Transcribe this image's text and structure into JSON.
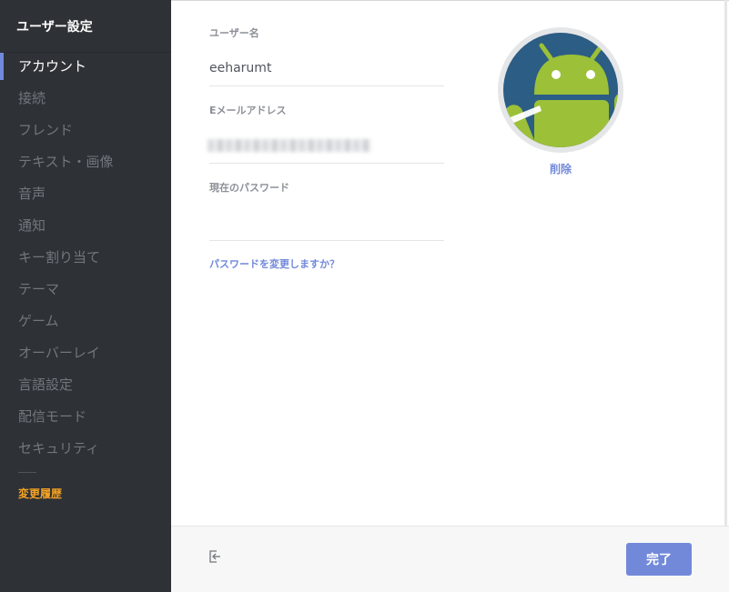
{
  "sidebar": {
    "title": "ユーザー設定",
    "items": [
      {
        "label": "アカウント",
        "active": true
      },
      {
        "label": "接続"
      },
      {
        "label": "フレンド"
      },
      {
        "label": "テキスト・画像"
      },
      {
        "label": "音声"
      },
      {
        "label": "通知"
      },
      {
        "label": "キー割り当て"
      },
      {
        "label": "テーマ"
      },
      {
        "label": "ゲーム"
      },
      {
        "label": "オーバーレイ"
      },
      {
        "label": "言語設定"
      },
      {
        "label": "配信モード"
      },
      {
        "label": "セキュリティ"
      }
    ],
    "changelog": "変更履歴"
  },
  "account": {
    "username_label": "ユーザー名",
    "username_value": "eeharumt",
    "email_label": "Eメールアドレス",
    "email_value": "(blurred)",
    "password_label": "現在のパスワード",
    "password_value": "",
    "change_password_link": "パスワードを変更しますか？",
    "avatar_remove": "削除",
    "avatar_icon": "android-avatar"
  },
  "footer": {
    "logout_icon": "logout-icon",
    "done_label": "完了"
  },
  "colors": {
    "sidebar_bg": "#2e3136",
    "accent": "#7289da",
    "changelog": "#f6a323",
    "avatar_bg": "#2c5d84",
    "android_green": "#9cc038"
  }
}
